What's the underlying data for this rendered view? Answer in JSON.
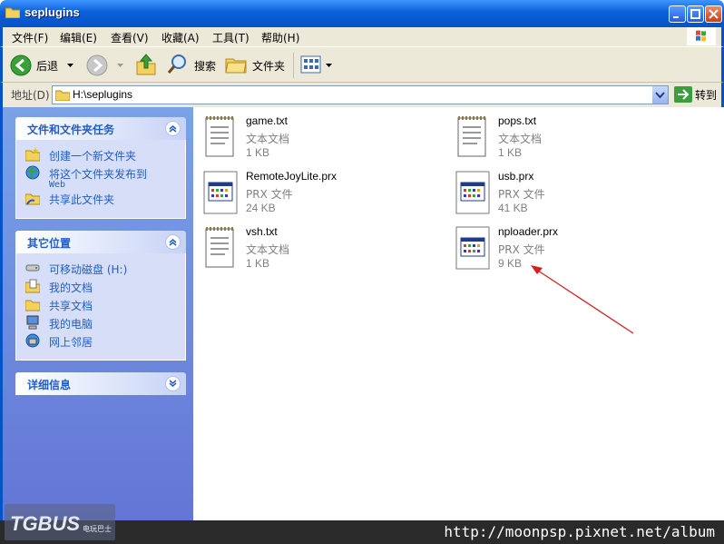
{
  "window": {
    "title": "seplugins"
  },
  "menu": [
    "文件(F)",
    "编辑(E)",
    "查看(V)",
    "收藏(A)",
    "工具(T)",
    "帮助(H)"
  ],
  "toolbar": {
    "back": "后退",
    "search": "搜索",
    "folders": "文件夹"
  },
  "address": {
    "label": "地址(D)",
    "value": "H:\\seplugins",
    "go": "转到"
  },
  "tasks": {
    "title": "文件和文件夹任务",
    "items": [
      "创建一个新文件夹",
      "将这个文件夹发布到",
      "共享此文件夹"
    ],
    "publish_sub": "Web"
  },
  "places": {
    "title": "其它位置",
    "items": [
      "可移动磁盘 (H:)",
      "我的文档",
      "共享文档",
      "我的电脑",
      "网上邻居"
    ]
  },
  "details": {
    "title": "详细信息"
  },
  "files": [
    {
      "name": "game.txt",
      "type": "文本文档",
      "size": "1 KB",
      "icon": "text-file-icon"
    },
    {
      "name": "pops.txt",
      "type": "文本文档",
      "size": "1 KB",
      "icon": "text-file-icon"
    },
    {
      "name": "RemoteJoyLite.prx",
      "type": "PRX 文件",
      "size": "24 KB",
      "icon": "prx-file-icon"
    },
    {
      "name": "usb.prx",
      "type": "PRX 文件",
      "size": "41 KB",
      "icon": "prx-file-icon"
    },
    {
      "name": "vsh.txt",
      "type": "文本文档",
      "size": "1 KB",
      "icon": "text-file-icon"
    },
    {
      "name": "nploader.prx",
      "type": "PRX 文件",
      "size": "9 KB",
      "icon": "prx-file-icon"
    }
  ],
  "watermark": {
    "logo": "TGBUS",
    "logo_sub": "电玩巴士",
    "url": "http://moonpsp.pixnet.net/album"
  },
  "colors": {
    "titlebar": "#0553c7",
    "pane": "#6d8ee0",
    "link": "#215dc6",
    "arrow": "#d42020"
  }
}
